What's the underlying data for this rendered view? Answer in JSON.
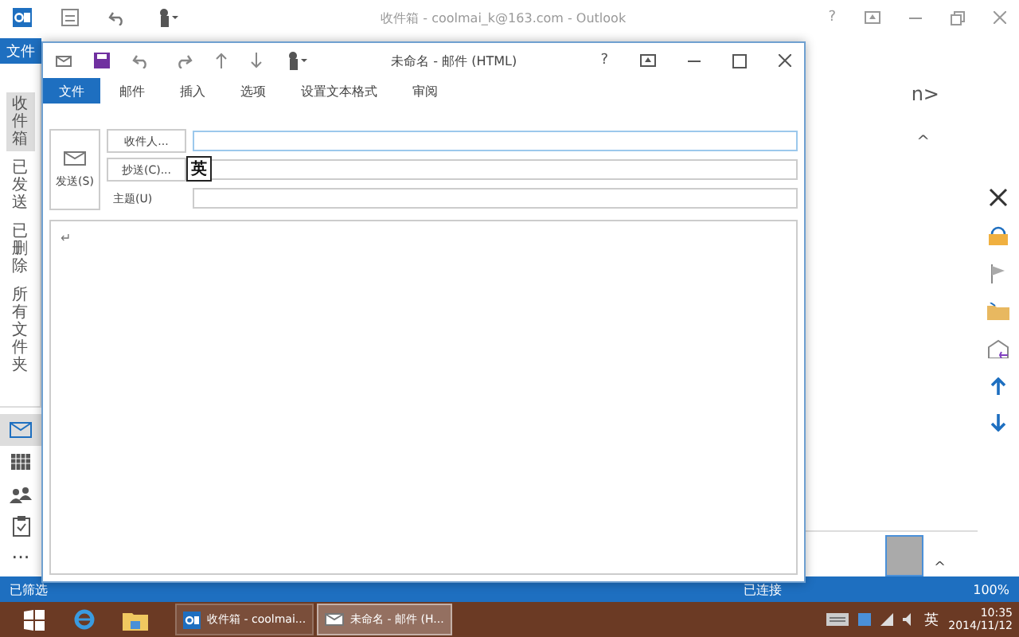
{
  "main_window": {
    "title": "收件箱 - coolmai_k@163.com - Outlook",
    "help": "?",
    "file_tab": "文件",
    "nav_folders": [
      {
        "label": "收件箱",
        "selected": true
      },
      {
        "label": "已发送",
        "selected": false
      },
      {
        "label": "已删除",
        "selected": false
      },
      {
        "label": "所有文件夹",
        "selected": false
      }
    ],
    "nav_modules": [
      {
        "kind": "mail",
        "selected": true
      },
      {
        "kind": "calendar",
        "selected": false
      },
      {
        "kind": "people",
        "selected": false
      },
      {
        "kind": "tasks",
        "selected": false
      },
      {
        "kind": "more",
        "label": "···",
        "selected": false
      }
    ],
    "preview_fragment": "n>",
    "collapse": "^",
    "people_collapse": "^",
    "status_bar": {
      "left": "已筛选",
      "connection": "已连接",
      "zoom": "100%"
    }
  },
  "compose": {
    "title": "未命名 - 邮件 (HTML)",
    "help": "?",
    "tabs": [
      {
        "label": "文件",
        "selected": true
      },
      {
        "label": "邮件",
        "selected": false
      },
      {
        "label": "插入",
        "selected": false
      },
      {
        "label": "选项",
        "selected": false
      },
      {
        "label": "设置文本格式",
        "selected": false
      },
      {
        "label": "审阅",
        "selected": false
      }
    ],
    "send_button": "发送(S)",
    "to_button": "收件人...",
    "cc_button": "抄送(C)...",
    "subject_label": "主题(U)",
    "body_mark": "↵",
    "ime_indicator": "英"
  },
  "taskbar": {
    "items": [
      {
        "kind": "outlook",
        "label": "收件箱 - coolmai...",
        "selected": false
      },
      {
        "kind": "compose",
        "label": "未命名 - 邮件 (H...",
        "selected": true
      }
    ],
    "ime": "英",
    "time": "10:35",
    "date": "2014/11/12"
  }
}
